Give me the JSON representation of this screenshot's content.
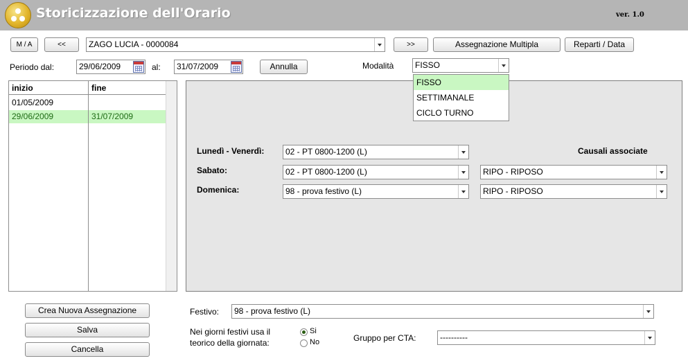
{
  "header": {
    "title": "Storicizzazione dell'Orario",
    "version": "ver. 1.0"
  },
  "toolbar": {
    "ma_label": "M / A",
    "prev_label": "<<",
    "employee_value": "ZAGO LUCIA - 0000084",
    "next_label": ">>",
    "multi_assign_label": "Assegnazione Multipla",
    "departments_label": "Reparti / Data"
  },
  "period": {
    "from_label": "Periodo dal:",
    "from_value": "29/06/2009",
    "to_label": "al:",
    "to_value": "31/07/2009",
    "cancel_label": "Annulla",
    "mode_label": "Modalità",
    "mode_value": "FISSO",
    "mode_options": [
      "FISSO",
      "SETTIMANALE",
      "CICLO TURNO"
    ]
  },
  "history_list": {
    "headers": {
      "start": "inizio",
      "end": "fine"
    },
    "rows": [
      {
        "start": "01/05/2009",
        "end": ""
      },
      {
        "start": "29/06/2009",
        "end": "31/07/2009"
      }
    ]
  },
  "schedule": {
    "causali_header": "Causali associate",
    "rows": [
      {
        "label": "Lunedì - Venerdì:",
        "orario": "02 - PT 0800-1200 (L)",
        "causale": ""
      },
      {
        "label": "Sabato:",
        "orario": "02 - PT 0800-1200 (L)",
        "causale": "RIPO - RIPOSO"
      },
      {
        "label": "Domenica:",
        "orario": "98 - prova festivo (L)",
        "causale": "RIPO - RIPOSO"
      }
    ]
  },
  "actions": {
    "create_label": "Crea Nuova Assegnazione",
    "save_label": "Salva",
    "delete_label": "Cancella"
  },
  "bottom": {
    "festivo_label": "Festivo:",
    "festivo_value": "98 - prova festivo (L)",
    "holiday_question_line1": "Nei giorni festivi usa il",
    "holiday_question_line2": "teorico della giornata:",
    "yes_label": "Si",
    "no_label": "No",
    "yes_selected": true,
    "cta_label": "Gruppo per CTA:",
    "cta_value": "----------"
  },
  "colors": {
    "header_bg": "#b5b5b5",
    "selection_bg": "#c9f7c2",
    "panel_bg": "#e6e6e6"
  }
}
